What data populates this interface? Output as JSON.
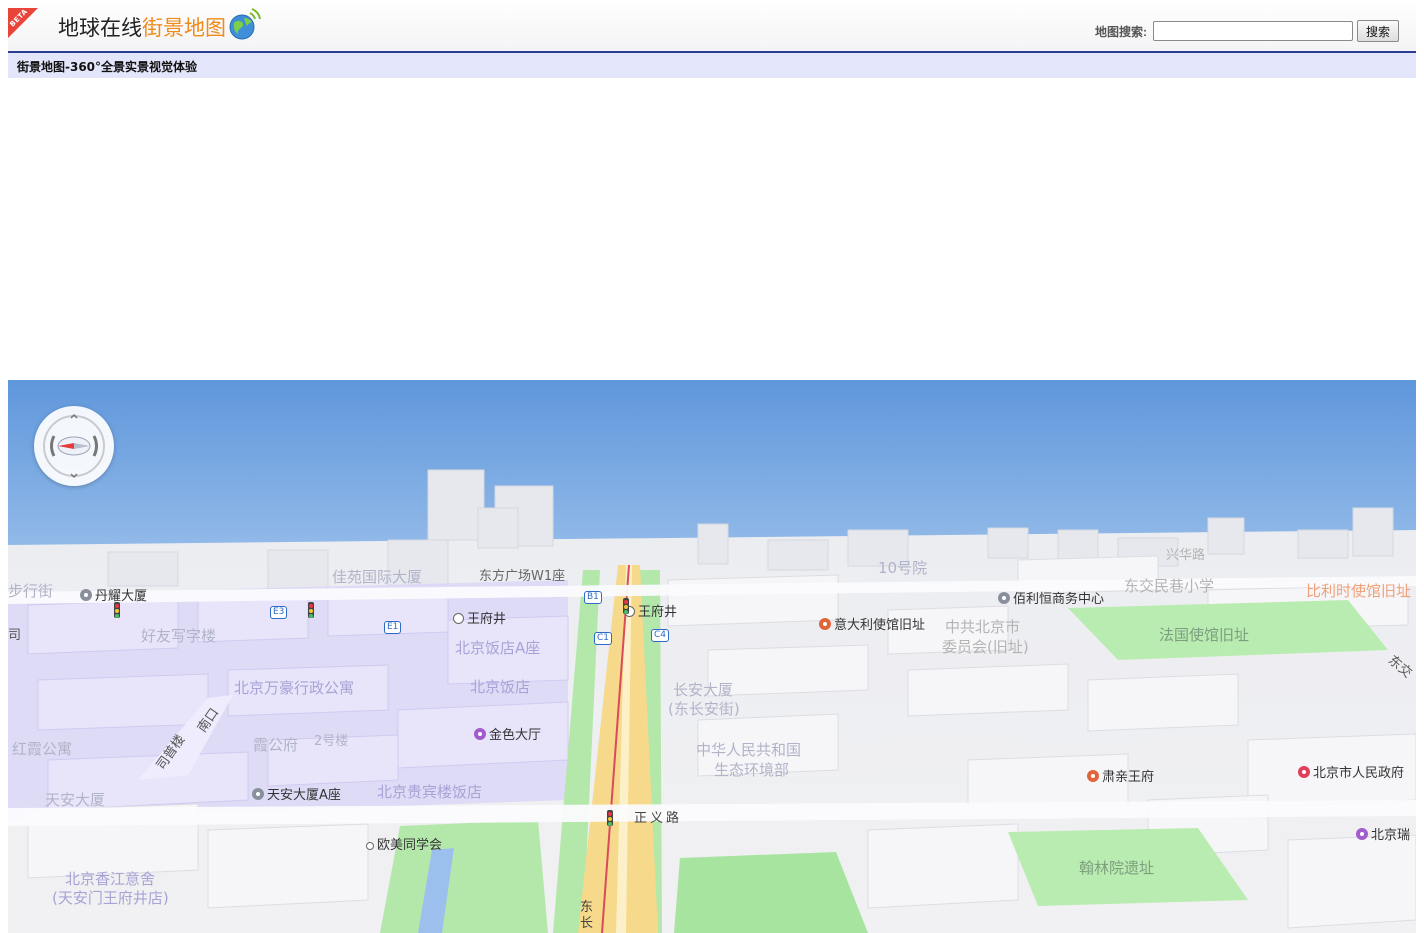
{
  "header": {
    "beta_badge": "BETA",
    "logo_text_dark": "地球在线",
    "logo_text_orange": "街景地图",
    "search_label": "地图搜索:",
    "search_value": "",
    "search_button": "搜索"
  },
  "subtitle": "街景地图-360°全景实景视觉体验",
  "streetview": {
    "poi_labels": [
      {
        "id": "danyao",
        "text": "丹耀大厦"
      },
      {
        "id": "wangfujing-w",
        "text": "王府井"
      },
      {
        "id": "wangfujing-e",
        "text": "王府井"
      },
      {
        "id": "jinse",
        "text": "金色大厅"
      },
      {
        "id": "tianan",
        "text": "天安大厦A座"
      },
      {
        "id": "oumei",
        "text": "欧美同学会"
      },
      {
        "id": "italy",
        "text": "意大利使馆旧址"
      },
      {
        "id": "bailiheng",
        "text": "佰利恒商务中心"
      },
      {
        "id": "suqin",
        "text": "肃亲王府"
      },
      {
        "id": "govt",
        "text": "北京市人民政府"
      },
      {
        "id": "beijingrui",
        "text": "北京瑞"
      }
    ],
    "area_labels": [
      {
        "id": "buxingjie",
        "text": "步行街"
      },
      {
        "id": "jiayuan",
        "text": "佳苑国际大厦"
      },
      {
        "id": "dongfang",
        "text": "东方广场W1座"
      },
      {
        "id": "haoyou",
        "text": "好友写字楼"
      },
      {
        "id": "wanhao",
        "text": "北京万豪行政公寓"
      },
      {
        "id": "hotel-a",
        "text": "北京饭店A座"
      },
      {
        "id": "hotel",
        "text": "北京饭店"
      },
      {
        "id": "hongxia",
        "text": "红霞公寓"
      },
      {
        "id": "xiagongfu",
        "text": "霞公府"
      },
      {
        "id": "building2",
        "text": "2号楼"
      },
      {
        "id": "tiananshasha",
        "text": "天安大厦"
      },
      {
        "id": "guibin",
        "text": "北京贵宾楼饭店"
      },
      {
        "id": "shangri-1",
        "text": "北京香江意舍"
      },
      {
        "id": "shangri-2",
        "text": "(天安门王府井店)"
      },
      {
        "id": "changan-1",
        "text": "长安大厦"
      },
      {
        "id": "changan-2",
        "text": "(东长安街)"
      },
      {
        "id": "env-1",
        "text": "中华人民共和国"
      },
      {
        "id": "env-2",
        "text": "生态环境部"
      },
      {
        "id": "no10",
        "text": "10号院"
      },
      {
        "id": "cpc-1",
        "text": "中共北京市"
      },
      {
        "id": "cpc-2",
        "text": "委员会(旧址)"
      },
      {
        "id": "school",
        "text": "东交民巷小学"
      },
      {
        "id": "xinghua",
        "text": "兴华路"
      },
      {
        "id": "france",
        "text": "法国使馆旧址"
      },
      {
        "id": "belgium",
        "text": "比利时使馆旧址"
      },
      {
        "id": "hanlin",
        "text": "翰林院遗址"
      },
      {
        "id": "nankou",
        "text": "南口"
      },
      {
        "id": "siyou",
        "text": "司普楼"
      },
      {
        "id": "dongjiao",
        "text": "东交"
      },
      {
        "id": "left-edge",
        "text": "司"
      }
    ],
    "road_labels": [
      {
        "id": "zhengyi",
        "text": "正义路"
      },
      {
        "id": "dongchang",
        "text": "东长"
      }
    ],
    "exit_badges": [
      "B1",
      "E3",
      "E1",
      "C1",
      "C4"
    ]
  },
  "colors": {
    "sky_top": "#5f97dc",
    "header_rule": "#2b3d8f",
    "subtitle_bg": "#e3e6fa",
    "logo_orange": "#f08a1a",
    "road_yellow": "#f6d98a",
    "green_area": "#aee8a6",
    "purple_area": "#d9d4f5"
  }
}
